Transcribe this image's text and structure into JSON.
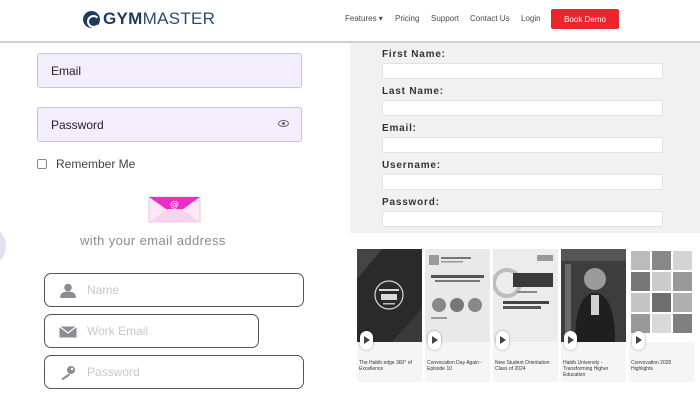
{
  "nav": {
    "logo_bold": "GYM",
    "logo_light": "MASTER",
    "features": "Features ▾",
    "pricing": "Pricing",
    "support": "Support",
    "contact": "Contact Us",
    "login": "Login",
    "book_demo": "Book Demo",
    "accent_color": "#e8262b"
  },
  "login_form": {
    "email_label": "Email",
    "password_label": "Password",
    "remember_label": "Remember Me",
    "with_email_text": "with your email address"
  },
  "signup_fields": {
    "name_placeholder": "Name",
    "work_email_placeholder": "Work Email",
    "password_placeholder": "Password"
  },
  "register_form": {
    "first_name": "First Name:",
    "last_name": "Last Name:",
    "email": "Email:",
    "username": "Username:",
    "password": "Password:"
  },
  "videos": [
    {
      "caption": "The Habib edge 360° of Excellence"
    },
    {
      "caption": "Convocation Day Again - Episode 10"
    },
    {
      "caption": "New Student Orientation Class of 2024"
    },
    {
      "caption": "Habib University - Transforming Higher Education"
    },
    {
      "caption": "Convocation 2020 Highlights"
    }
  ]
}
